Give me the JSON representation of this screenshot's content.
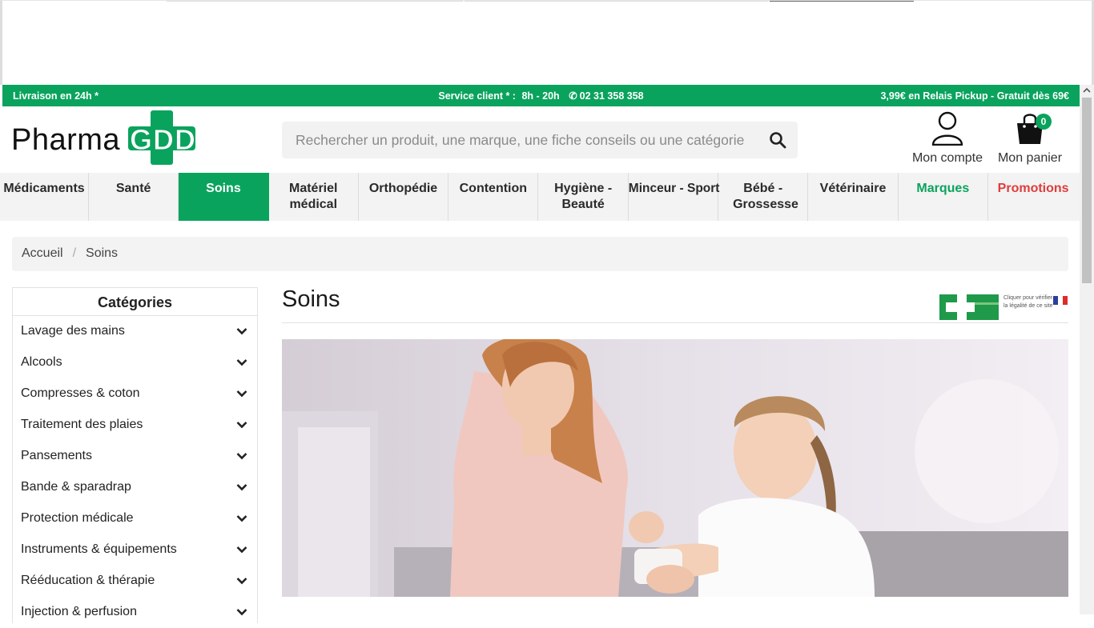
{
  "topbar": {
    "delivery": "Livraison en 24h *",
    "service_label": "Service client * :",
    "service_hours": "8h - 20h",
    "phone": "02 31 358 358",
    "relay": "3,99€ en Relais Pickup - Gratuit dès 69€"
  },
  "logo": {
    "part1": "Pharma",
    "part2": "GDD"
  },
  "search": {
    "placeholder": "Rechercher un produit, une marque, une fiche conseils ou une catégorie"
  },
  "account": {
    "label": "Mon compte"
  },
  "cart": {
    "label": "Mon panier",
    "count": "0"
  },
  "nav": [
    "Médicaments",
    "Santé",
    "Soins",
    "Matériel médical",
    "Orthopédie",
    "Contention",
    "Hygiène - Beauté",
    "Minceur - Sport",
    "Bébé - Grossesse",
    "Vétérinaire",
    "Marques",
    "Promotions"
  ],
  "nav_active": "Soins",
  "breadcrumb": {
    "home": "Accueil",
    "current": "Soins"
  },
  "sidebar": {
    "title": "Catégories",
    "categories": [
      "Lavage des mains",
      "Alcools",
      "Compresses & coton",
      "Traitement des plaies",
      "Pansements",
      "Bande & sparadrap",
      "Protection médicale",
      "Instruments & équipements",
      "Rééducation & thérapie",
      "Injection & perfusion"
    ]
  },
  "main": {
    "title": "Soins"
  },
  "legal_badge": {
    "text": "Cliquer pour vérifier la légalité de ce site"
  },
  "colors": {
    "brand_green": "#0aa35d",
    "promo_red": "#e03c3c"
  }
}
